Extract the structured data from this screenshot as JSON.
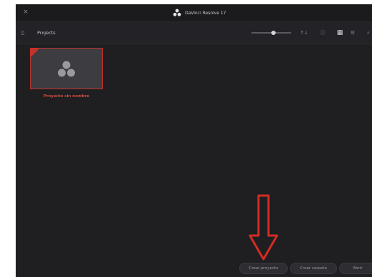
{
  "window": {
    "title": "DaVinci Resolve 17",
    "close_glyph": "×"
  },
  "toolbar": {
    "breadcrumb": "Projects",
    "sidebar_toggle_glyph": "▯",
    "icons": {
      "sort": "↑↓",
      "info": "ⓘ",
      "grid": "▦",
      "settings": "⚙",
      "search": "⌕"
    },
    "zoom_slider_value": 0.55
  },
  "projects": [
    {
      "name": "Proyecto sin nombre"
    }
  ],
  "buttons": {
    "new_project": "Crear proyecto",
    "new_folder": "Crear carpeta",
    "open": "Abrir"
  },
  "colors": {
    "accent_red": "#c5322b",
    "background": "#1f1f22"
  }
}
